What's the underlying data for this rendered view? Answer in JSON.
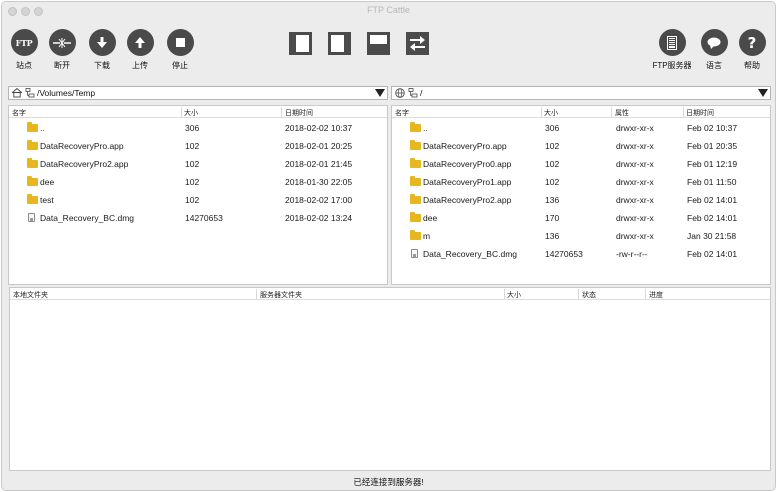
{
  "window": {
    "title": "FTP Cattle"
  },
  "toolbar": {
    "site": {
      "label": "站点",
      "icon": "FTP"
    },
    "disconnect": {
      "label": "断开"
    },
    "download": {
      "label": "下载"
    },
    "upload": {
      "label": "上传"
    },
    "stop": {
      "label": "停止"
    },
    "ftp_server": {
      "label": "FTP服务器"
    },
    "language": {
      "label": "语言"
    },
    "help": {
      "label": "帮助",
      "icon": "?"
    }
  },
  "local": {
    "path": "/Volumes/Temp",
    "columns": [
      "名字",
      "大小",
      "日期时间"
    ],
    "files": [
      {
        "icon": "folder",
        "name": "..",
        "size": "306",
        "date": "2018-02-02 10:37"
      },
      {
        "icon": "folder",
        "name": "DataRecoveryPro.app",
        "size": "102",
        "date": "2018-02-01 20:25"
      },
      {
        "icon": "folder",
        "name": "DataRecoveryPro2.app",
        "size": "102",
        "date": "2018-02-01 21:45"
      },
      {
        "icon": "folder",
        "name": "dee",
        "size": "102",
        "date": "2018-01-30 22:05"
      },
      {
        "icon": "folder",
        "name": "test",
        "size": "102",
        "date": "2018-02-02 17:00"
      },
      {
        "icon": "file",
        "name": "Data_Recovery_BC.dmg",
        "size": "14270653",
        "date": "2018-02-02 13:24"
      }
    ]
  },
  "remote": {
    "path": "/",
    "columns": [
      "名字",
      "大小",
      "属性",
      "日期时间"
    ],
    "files": [
      {
        "icon": "folder",
        "name": "..",
        "size": "306",
        "perm": "drwxr-xr-x",
        "date": "Feb 02 10:37"
      },
      {
        "icon": "folder",
        "name": "DataRecoveryPro.app",
        "size": "102",
        "perm": "drwxr-xr-x",
        "date": "Feb 01 20:35"
      },
      {
        "icon": "folder",
        "name": "DataRecoveryPro0.app",
        "size": "102",
        "perm": "drwxr-xr-x",
        "date": "Feb 01 12:19"
      },
      {
        "icon": "folder",
        "name": "DataRecoveryPro1.app",
        "size": "102",
        "perm": "drwxr-xr-x",
        "date": "Feb 01 11:50"
      },
      {
        "icon": "folder",
        "name": "DataRecoveryPro2.app",
        "size": "136",
        "perm": "drwxr-xr-x",
        "date": "Feb 02 14:01"
      },
      {
        "icon": "folder",
        "name": "dee",
        "size": "170",
        "perm": "drwxr-xr-x",
        "date": "Feb 02 14:01"
      },
      {
        "icon": "folder",
        "name": "m",
        "size": "136",
        "perm": "drwxr-xr-x",
        "date": "Jan 30 21:58"
      },
      {
        "icon": "file",
        "name": "Data_Recovery_BC.dmg",
        "size": "14270653",
        "perm": "-rw-r--r--",
        "date": "Feb 02 14:01"
      }
    ]
  },
  "queue": {
    "columns": [
      "本地文件夹",
      "服务器文件夹",
      "大小",
      "状态",
      "进度"
    ]
  },
  "status": {
    "text": "已经连接到服务器!"
  }
}
